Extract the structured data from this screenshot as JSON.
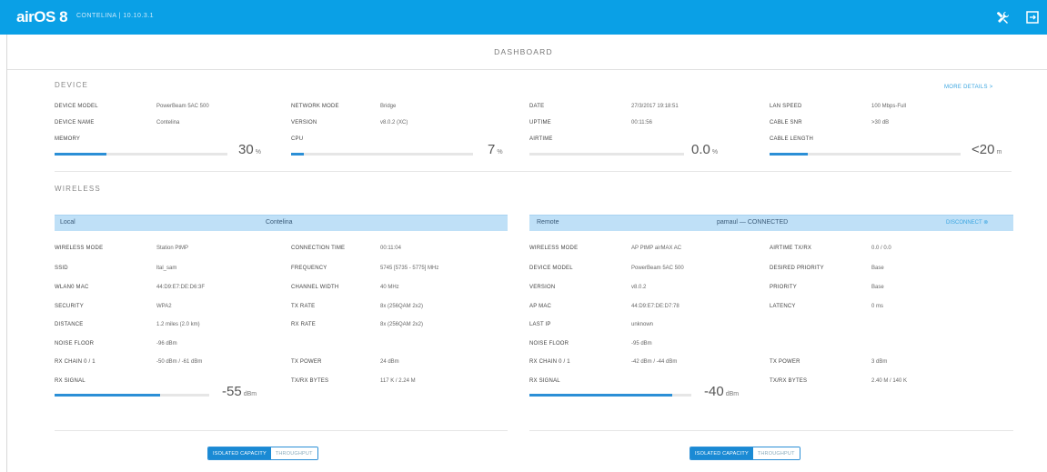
{
  "topbar": {
    "logo": "airOS 8",
    "device": "CONTELINA  | 10.10.3.1",
    "tools_icon": "wrench-screwdriver-icon",
    "logout_icon": "logout-icon"
  },
  "dashboard": {
    "title": "DASHBOARD"
  },
  "device": {
    "heading": "DEVICE",
    "more_details": "MORE DETAILS  >",
    "model_label": "DEVICE MODEL",
    "model_value": "PowerBeam 5AC 500",
    "name_label": "DEVICE NAME",
    "name_value": "Contelina",
    "memory_label": "MEMORY",
    "memory_value": "30",
    "memory_unit": "%",
    "memory_pct": 30,
    "netmode_label": "NETWORK MODE",
    "netmode_value": "Bridge",
    "version_label": "VERSION",
    "version_value": "v8.0.2 (XC)",
    "cpu_label": "CPU",
    "cpu_value": "7",
    "cpu_unit": "%",
    "cpu_pct": 7,
    "date_label": "DATE",
    "date_value": "27/3/2017 19:18:51",
    "uptime_label": "UPTIME",
    "uptime_value": "00:11:56",
    "airtime_label": "AIRTIME",
    "airtime_value": "0.0",
    "airtime_unit": "%",
    "airtime_pct": 0,
    "lanspeed_label": "LAN SPEED",
    "lanspeed_value": "100 Mbps-Full",
    "cablesnr_label": "CABLE SNR",
    "cablesnr_value": ">30 dB",
    "cablelen_label": "CABLE LENGTH",
    "cablelen_value": "<20",
    "cablelen_unit": "m",
    "cablelen_pct": 20
  },
  "wireless": {
    "heading": "WIRELESS",
    "local": {
      "title": "Local",
      "name": "Contelina",
      "mode_label": "WIRELESS MODE",
      "mode_value": "Station PtMP",
      "ssid_label": "SSID",
      "ssid_value": "ltal_sam",
      "wlanmac_label": "WLAN0 MAC",
      "wlanmac_value": "44:D9:E7:DE:D6:3F",
      "security_label": "SECURITY",
      "security_value": "WPA2",
      "distance_label": "DISTANCE",
      "distance_value": "1.2 miles (2.0 km)",
      "noise_label": "NOISE FLOOR",
      "noise_value": "-96 dBm",
      "rxchain_label": "RX CHAIN 0 / 1",
      "rxchain_value": "-50 dBm / -61 dBm",
      "rxsignal_label": "RX SIGNAL",
      "rxsignal_value": "-55",
      "rxsignal_unit": "dBm",
      "rxsignal_pct": 68,
      "conntime_label": "CONNECTION TIME",
      "conntime_value": "00:11:04",
      "freq_label": "FREQUENCY",
      "freq_value": "5745 [5735 - 5775] MHz",
      "width_label": "CHANNEL WIDTH",
      "width_value": "40 MHz",
      "txrate_label": "TX RATE",
      "txrate_value": "8x (256QAM 2x2)",
      "rxrate_label": "RX RATE",
      "rxrate_value": "8x (256QAM 2x2)",
      "txpower_label": "TX POWER",
      "txpower_value": "24 dBm",
      "bytes_label": "TX/RX BYTES",
      "bytes_value": "117 K / 2.24 M"
    },
    "remote": {
      "title": "Remote",
      "name": "pamaul — CONNECTED",
      "disconnect": "DISCONNECT  ⊗",
      "mode_label": "WIRELESS MODE",
      "mode_value": "AP PtMP airMAX AC",
      "model_label": "DEVICE MODEL",
      "model_value": "PowerBeam 5AC 500",
      "version_label": "VERSION",
      "version_value": "v8.0.2",
      "apmac_label": "AP MAC",
      "apmac_value": "44:D9:E7:DE:D7:78",
      "lastip_label": "LAST IP",
      "lastip_value": "unknown",
      "noise_label": "NOISE FLOOR",
      "noise_value": "-95 dBm",
      "rxchain_label": "RX CHAIN 0 / 1",
      "rxchain_value": "-42 dBm / -44 dBm",
      "rxsignal_label": "RX SIGNAL",
      "rxsignal_value": "-40",
      "rxsignal_unit": "dBm",
      "rxsignal_pct": 88,
      "airtime_label": "AIRTIME TX/RX",
      "airtime_value": "0.0 / 0.0",
      "desired_label": "DESIRED PRIORITY",
      "desired_value": "Base",
      "priority_label": "PRIORITY",
      "priority_value": "Base",
      "latency_label": "LATENCY",
      "latency_value": "0 ms",
      "txpower_label": "TX POWER",
      "txpower_value": "3 dBm",
      "bytes_label": "TX/RX BYTES",
      "bytes_value": "2.40 M / 140 K"
    },
    "toggle": {
      "on": "ISOLATED CAPACITY",
      "off": "THROUGHPUT"
    }
  },
  "colors": {
    "topbar": "#0aa0e6",
    "bar": "#2b8fd6",
    "panel_head": "#bfe0f7"
  }
}
